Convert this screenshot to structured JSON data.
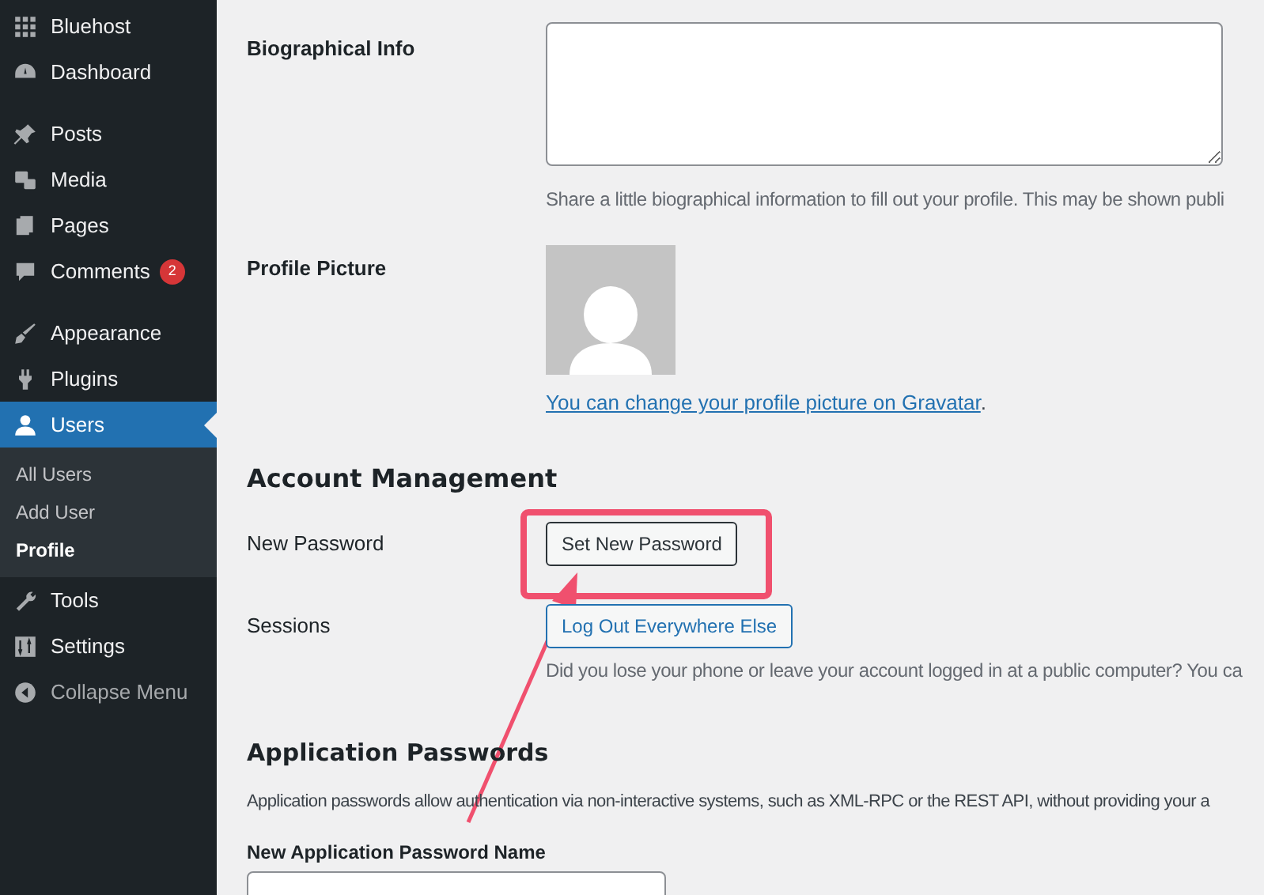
{
  "sidebar": {
    "groups": [
      [
        {
          "label": "Bluehost",
          "selected": false
        },
        {
          "label": "Dashboard",
          "selected": false
        }
      ],
      [
        {
          "label": "Posts",
          "selected": false
        },
        {
          "label": "Media",
          "selected": false
        },
        {
          "label": "Pages",
          "selected": false
        },
        {
          "label": "Comments",
          "selected": false,
          "badge": "2"
        }
      ],
      [
        {
          "label": "Appearance",
          "selected": false
        },
        {
          "label": "Plugins",
          "selected": false
        },
        {
          "label": "Users",
          "selected": true,
          "children": [
            {
              "label": "All Users",
              "selected": false
            },
            {
              "label": "Add User",
              "selected": false
            },
            {
              "label": "Profile",
              "selected": true
            }
          ]
        },
        {
          "label": "Tools",
          "selected": false
        },
        {
          "label": "Settings",
          "selected": false
        },
        {
          "label": "Collapse Menu",
          "selected": false
        }
      ]
    ]
  },
  "bio": {
    "label": "Biographical Info",
    "description": "Share a little biographical information to fill out your profile. This may be shown publi"
  },
  "picture": {
    "label": "Profile Picture",
    "link": "You can change your profile picture on Gravatar",
    "after": "."
  },
  "account": {
    "heading": "Account Management",
    "password_label": "New Password",
    "password_button": "Set New Password",
    "sessions_label": "Sessions",
    "sessions_button": "Log Out Everywhere Else",
    "sessions_description": "Did you lose your phone or leave your account logged in at a public computer? You ca"
  },
  "app_passwords": {
    "heading": "Application Passwords",
    "description": "Application passwords allow authentication via non-interactive systems, such as XML-RPC or the REST API, without providing your a",
    "name_label": "New Application Password Name"
  }
}
